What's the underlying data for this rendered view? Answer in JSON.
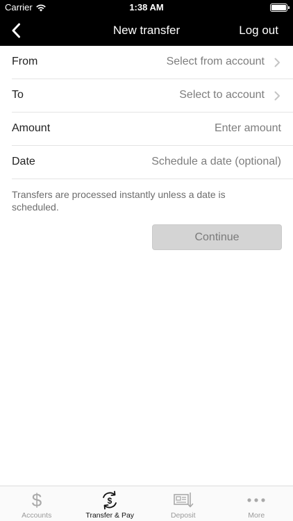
{
  "status_bar": {
    "carrier": "Carrier",
    "time": "1:38 AM"
  },
  "nav": {
    "title": "New transfer",
    "logout_label": "Log out"
  },
  "form": {
    "from": {
      "label": "From",
      "value": "Select from account"
    },
    "to": {
      "label": "To",
      "value": "Select to account"
    },
    "amount": {
      "label": "Amount",
      "placeholder": "Enter amount"
    },
    "date": {
      "label": "Date",
      "placeholder": "Schedule a date (optional)"
    }
  },
  "note": "Transfers are processed instantly unless a date is scheduled.",
  "continue_label": "Continue",
  "tabs": [
    {
      "label": "Accounts",
      "icon": "dollar-icon",
      "active": false
    },
    {
      "label": "Transfer & Pay",
      "icon": "transfer-pay-icon",
      "active": true
    },
    {
      "label": "Deposit",
      "icon": "check-deposit-icon",
      "active": false
    },
    {
      "label": "More",
      "icon": "more-dots-icon",
      "active": false
    }
  ],
  "colors": {
    "header_bg": "#000000",
    "button_disabled": "#d4d4d4",
    "tab_inactive": "#9a9a9a",
    "tab_active": "#111111"
  }
}
